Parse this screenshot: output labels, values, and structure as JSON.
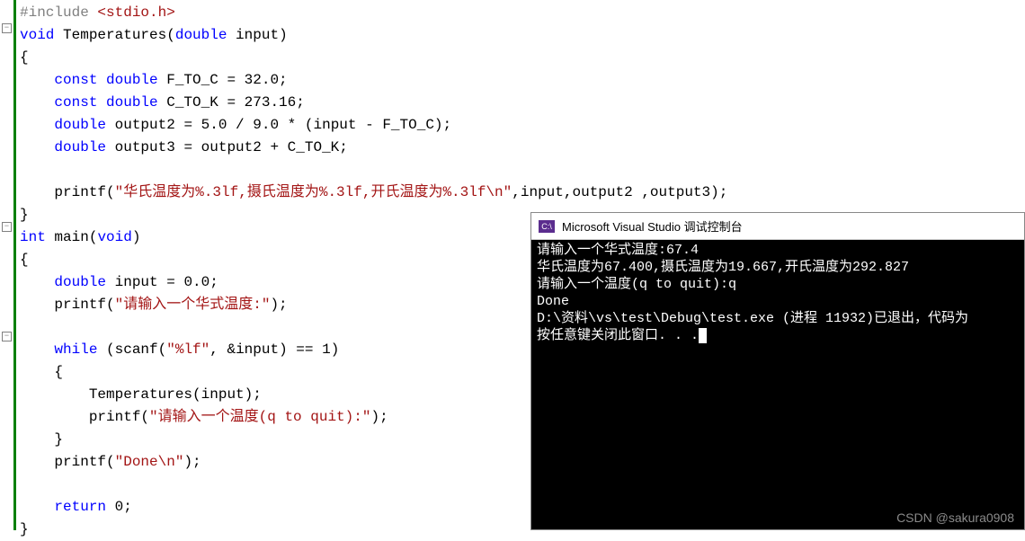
{
  "code": {
    "lines": [
      {
        "indent": "",
        "tokens": [
          {
            "cls": "preprocessor",
            "t": "#include "
          },
          {
            "cls": "include-path",
            "t": "<stdio.h>"
          }
        ]
      },
      {
        "indent": "",
        "tokens": [
          {
            "cls": "keyword",
            "t": "void"
          },
          {
            "cls": "identifier",
            "t": " Temperatures"
          },
          {
            "cls": "paren",
            "t": "("
          },
          {
            "cls": "keyword",
            "t": "double"
          },
          {
            "cls": "identifier",
            "t": " input"
          },
          {
            "cls": "paren",
            "t": ")"
          }
        ]
      },
      {
        "indent": "",
        "tokens": [
          {
            "cls": "brace",
            "t": "{"
          }
        ]
      },
      {
        "indent": "    ",
        "tokens": [
          {
            "cls": "keyword",
            "t": "const double"
          },
          {
            "cls": "identifier",
            "t": " F_TO_C "
          },
          {
            "cls": "operator",
            "t": "= "
          },
          {
            "cls": "number",
            "t": "32.0"
          },
          {
            "cls": "operator",
            "t": ";"
          }
        ]
      },
      {
        "indent": "    ",
        "tokens": [
          {
            "cls": "keyword",
            "t": "const double"
          },
          {
            "cls": "identifier",
            "t": " C_TO_K "
          },
          {
            "cls": "operator",
            "t": "= "
          },
          {
            "cls": "number",
            "t": "273.16"
          },
          {
            "cls": "operator",
            "t": ";"
          }
        ]
      },
      {
        "indent": "    ",
        "tokens": [
          {
            "cls": "keyword",
            "t": "double"
          },
          {
            "cls": "identifier",
            "t": " output2 "
          },
          {
            "cls": "operator",
            "t": "= "
          },
          {
            "cls": "number",
            "t": "5.0"
          },
          {
            "cls": "operator",
            "t": " / "
          },
          {
            "cls": "number",
            "t": "9.0"
          },
          {
            "cls": "operator",
            "t": " * "
          },
          {
            "cls": "paren",
            "t": "("
          },
          {
            "cls": "identifier",
            "t": "input "
          },
          {
            "cls": "operator",
            "t": "- "
          },
          {
            "cls": "identifier",
            "t": "F_TO_C"
          },
          {
            "cls": "paren",
            "t": ")"
          },
          {
            "cls": "operator",
            "t": ";"
          }
        ]
      },
      {
        "indent": "    ",
        "tokens": [
          {
            "cls": "keyword",
            "t": "double"
          },
          {
            "cls": "identifier",
            "t": " output3 "
          },
          {
            "cls": "operator",
            "t": "= "
          },
          {
            "cls": "identifier",
            "t": "output2 "
          },
          {
            "cls": "operator",
            "t": "+ "
          },
          {
            "cls": "identifier",
            "t": "C_TO_K"
          },
          {
            "cls": "operator",
            "t": ";"
          }
        ]
      },
      {
        "indent": "",
        "tokens": []
      },
      {
        "indent": "    ",
        "tokens": [
          {
            "cls": "func-call",
            "t": "printf"
          },
          {
            "cls": "paren",
            "t": "("
          },
          {
            "cls": "string",
            "t": "\"华氏温度为%.3lf,摄氏温度为%.3lf,开氏温度为%.3lf\\n\""
          },
          {
            "cls": "operator",
            "t": ","
          },
          {
            "cls": "identifier",
            "t": "input"
          },
          {
            "cls": "operator",
            "t": ","
          },
          {
            "cls": "identifier",
            "t": "output2 "
          },
          {
            "cls": "operator",
            "t": ","
          },
          {
            "cls": "identifier",
            "t": "output3"
          },
          {
            "cls": "paren",
            "t": ")"
          },
          {
            "cls": "operator",
            "t": ";"
          }
        ]
      },
      {
        "indent": "",
        "tokens": [
          {
            "cls": "brace",
            "t": "}"
          }
        ]
      },
      {
        "indent": "",
        "tokens": [
          {
            "cls": "keyword",
            "t": "int"
          },
          {
            "cls": "identifier",
            "t": " main"
          },
          {
            "cls": "paren",
            "t": "("
          },
          {
            "cls": "keyword",
            "t": "void"
          },
          {
            "cls": "paren",
            "t": ")"
          }
        ]
      },
      {
        "indent": "",
        "tokens": [
          {
            "cls": "brace",
            "t": "{"
          }
        ]
      },
      {
        "indent": "    ",
        "tokens": [
          {
            "cls": "keyword",
            "t": "double"
          },
          {
            "cls": "identifier",
            "t": " input "
          },
          {
            "cls": "operator",
            "t": "= "
          },
          {
            "cls": "number",
            "t": "0.0"
          },
          {
            "cls": "operator",
            "t": ";"
          }
        ]
      },
      {
        "indent": "    ",
        "tokens": [
          {
            "cls": "func-call",
            "t": "printf"
          },
          {
            "cls": "paren",
            "t": "("
          },
          {
            "cls": "string",
            "t": "\"请输入一个华式温度:\""
          },
          {
            "cls": "paren",
            "t": ")"
          },
          {
            "cls": "operator",
            "t": ";"
          }
        ]
      },
      {
        "indent": "",
        "tokens": []
      },
      {
        "indent": "    ",
        "tokens": [
          {
            "cls": "keyword",
            "t": "while "
          },
          {
            "cls": "paren",
            "t": "("
          },
          {
            "cls": "func-call",
            "t": "scanf"
          },
          {
            "cls": "paren",
            "t": "("
          },
          {
            "cls": "string",
            "t": "\"%lf\""
          },
          {
            "cls": "operator",
            "t": ", &"
          },
          {
            "cls": "identifier",
            "t": "input"
          },
          {
            "cls": "paren",
            "t": ")"
          },
          {
            "cls": "operator",
            "t": " == "
          },
          {
            "cls": "number",
            "t": "1"
          },
          {
            "cls": "paren",
            "t": ")"
          }
        ]
      },
      {
        "indent": "    ",
        "tokens": [
          {
            "cls": "brace",
            "t": "{"
          }
        ]
      },
      {
        "indent": "        ",
        "tokens": [
          {
            "cls": "func-call",
            "t": "Temperatures"
          },
          {
            "cls": "paren",
            "t": "("
          },
          {
            "cls": "identifier",
            "t": "input"
          },
          {
            "cls": "paren",
            "t": ")"
          },
          {
            "cls": "operator",
            "t": ";"
          }
        ]
      },
      {
        "indent": "        ",
        "tokens": [
          {
            "cls": "func-call",
            "t": "printf"
          },
          {
            "cls": "paren",
            "t": "("
          },
          {
            "cls": "string",
            "t": "\"请输入一个温度(q to quit):\""
          },
          {
            "cls": "paren",
            "t": ")"
          },
          {
            "cls": "operator",
            "t": ";"
          }
        ]
      },
      {
        "indent": "    ",
        "tokens": [
          {
            "cls": "brace",
            "t": "}"
          }
        ]
      },
      {
        "indent": "    ",
        "tokens": [
          {
            "cls": "func-call",
            "t": "printf"
          },
          {
            "cls": "paren",
            "t": "("
          },
          {
            "cls": "string",
            "t": "\"Done\\n\""
          },
          {
            "cls": "paren",
            "t": ")"
          },
          {
            "cls": "operator",
            "t": ";"
          }
        ]
      },
      {
        "indent": "",
        "tokens": []
      },
      {
        "indent": "    ",
        "tokens": [
          {
            "cls": "keyword",
            "t": "return "
          },
          {
            "cls": "number",
            "t": "0"
          },
          {
            "cls": "operator",
            "t": ";"
          }
        ]
      },
      {
        "indent": "",
        "tokens": [
          {
            "cls": "brace",
            "t": "}"
          }
        ]
      }
    ]
  },
  "folds": [
    {
      "line": 1,
      "symbol": "−"
    },
    {
      "line": 10,
      "symbol": "−"
    },
    {
      "line": 15,
      "symbol": "−"
    }
  ],
  "console": {
    "icon_text": "C:\\",
    "title": "Microsoft Visual Studio 调试控制台",
    "lines": [
      "请输入一个华式温度:67.4",
      "华氏温度为67.400,摄氏温度为19.667,开氏温度为292.827",
      "请输入一个温度(q to quit):q",
      "Done",
      "",
      "D:\\资料\\vs\\test\\Debug\\test.exe (进程 11932)已退出，代码为",
      "按任意键关闭此窗口. . ."
    ]
  },
  "watermark": "CSDN @sakura0908"
}
